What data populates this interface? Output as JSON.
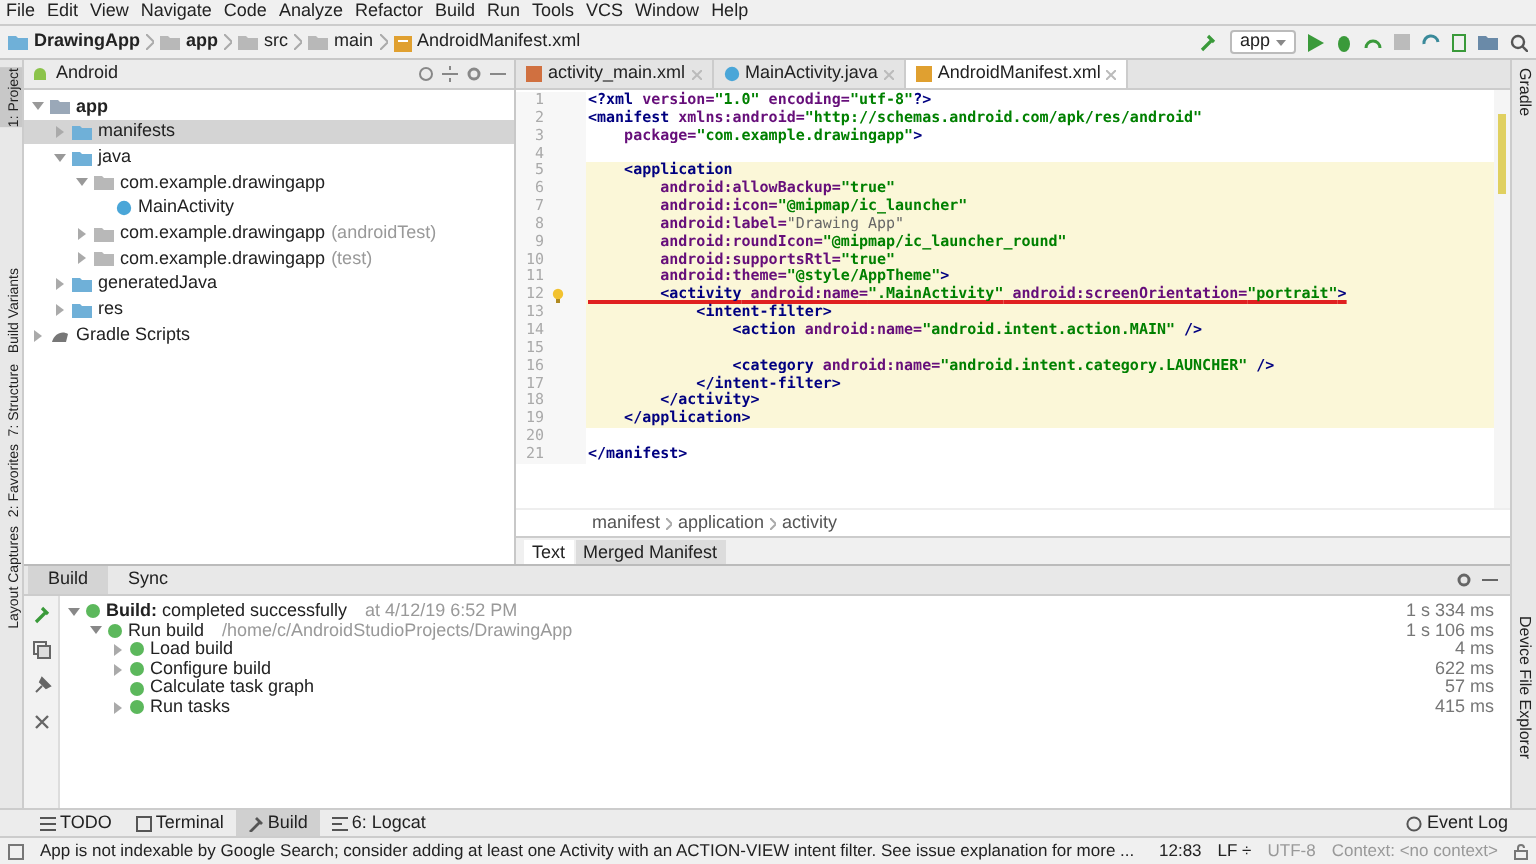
{
  "menu": [
    "File",
    "Edit",
    "View",
    "Navigate",
    "Code",
    "Analyze",
    "Refactor",
    "Build",
    "Run",
    "Tools",
    "VCS",
    "Window",
    "Help"
  ],
  "breadcrumb": [
    "DrawingApp",
    "app",
    "src",
    "main",
    "AndroidManifest.xml"
  ],
  "run_config": "app",
  "left_stripe": [
    {
      "label": "1: Project",
      "selected": true
    },
    {
      "label": "Build Variants",
      "selected": false
    },
    {
      "label": "7: Structure",
      "selected": false
    },
    {
      "label": "2: Favorites",
      "selected": false
    },
    {
      "label": "Layout Captures",
      "selected": false
    }
  ],
  "right_stripe": [
    "Gradle",
    "Device File Explorer"
  ],
  "project": {
    "view": "Android",
    "tree": [
      {
        "label": "app",
        "kind": "module",
        "expanded": true,
        "selected": false,
        "children": [
          {
            "label": "manifests",
            "kind": "folder",
            "expanded": false,
            "selected": true
          },
          {
            "label": "java",
            "kind": "folder",
            "expanded": true,
            "selected": false,
            "children": [
              {
                "label": "com.example.drawingapp",
                "kind": "package",
                "expanded": true,
                "selected": false,
                "children": [
                  {
                    "label": "MainActivity",
                    "kind": "class",
                    "selected": false
                  }
                ]
              },
              {
                "label": "com.example.drawingapp",
                "note": "(androidTest)",
                "kind": "package",
                "expanded": false,
                "selected": false
              },
              {
                "label": "com.example.drawingapp",
                "note": "(test)",
                "kind": "package",
                "expanded": false,
                "selected": false
              }
            ]
          },
          {
            "label": "generatedJava",
            "kind": "folder",
            "expanded": false,
            "selected": false
          },
          {
            "label": "res",
            "kind": "folder",
            "expanded": false,
            "selected": false
          }
        ]
      },
      {
        "label": "Gradle Scripts",
        "kind": "gradle",
        "expanded": false,
        "selected": false
      }
    ]
  },
  "editor_tabs": [
    {
      "label": "activity_main.xml",
      "kind": "layout",
      "selected": false
    },
    {
      "label": "MainActivity.java",
      "kind": "class",
      "selected": false
    },
    {
      "label": "AndroidManifest.xml",
      "kind": "manifest",
      "selected": true
    }
  ],
  "code": [
    {
      "number": "1",
      "highlighted": false,
      "tokens": [
        {
          "kind": "tag",
          "text": "<?xml"
        },
        {
          "kind": "attr",
          "text": " version="
        },
        {
          "kind": "val",
          "text": "\"1.0\""
        },
        {
          "kind": "attr",
          "text": " encoding="
        },
        {
          "kind": "val",
          "text": "\"utf-8\""
        },
        {
          "kind": "tag",
          "text": "?>"
        }
      ]
    },
    {
      "number": "2",
      "highlighted": false,
      "tokens": [
        {
          "kind": "tag",
          "text": "<manifest"
        },
        {
          "kind": "attr",
          "text": " xmlns:android="
        },
        {
          "kind": "val",
          "text": "\"http://schemas.android.com/apk/res/android\""
        }
      ]
    },
    {
      "number": "3",
      "highlighted": false,
      "tokens": [
        {
          "kind": "attr",
          "text": "    package="
        },
        {
          "kind": "val",
          "text": "\"com.example.drawingapp\""
        },
        {
          "kind": "tag",
          "text": ">"
        }
      ]
    },
    {
      "number": "4",
      "highlighted": false
    },
    {
      "number": "5",
      "highlighted": true,
      "tokens": [
        {
          "kind": "tag",
          "text": "    <application"
        }
      ]
    },
    {
      "number": "6",
      "highlighted": true,
      "tokens": [
        {
          "kind": "attr",
          "text": "        android:allowBackup="
        },
        {
          "kind": "val",
          "text": "\"true\""
        }
      ]
    },
    {
      "number": "7",
      "highlighted": true,
      "tokens": [
        {
          "kind": "attr",
          "text": "        android:icon="
        },
        {
          "kind": "val",
          "text": "\"@mipmap/ic_launcher\""
        }
      ]
    },
    {
      "number": "8",
      "highlighted": true,
      "tokens": [
        {
          "kind": "attr",
          "text": "        android:label="
        },
        {
          "kind": "fold",
          "text": "\"Drawing App\""
        }
      ]
    },
    {
      "number": "9",
      "highlighted": true,
      "tokens": [
        {
          "kind": "attr",
          "text": "        android:roundIcon="
        },
        {
          "kind": "val",
          "text": "\"@mipmap/ic_launcher_round\""
        }
      ]
    },
    {
      "number": "10",
      "highlighted": true,
      "tokens": [
        {
          "kind": "attr",
          "text": "        android:supportsRtl="
        },
        {
          "kind": "val",
          "text": "\"true\""
        }
      ]
    },
    {
      "number": "11",
      "highlighted": true,
      "tokens": [
        {
          "kind": "attr",
          "text": "        android:theme="
        },
        {
          "kind": "val",
          "text": "\"@style/AppTheme\""
        },
        {
          "kind": "tag",
          "text": ">"
        }
      ]
    },
    {
      "number": "12",
      "highlighted": true,
      "bulb": true,
      "underlined": true,
      "tokens": [
        {
          "kind": "tag",
          "text": "        <activity"
        },
        {
          "kind": "attr",
          "text": " android:name="
        },
        {
          "kind": "val",
          "text": "\".MainActivity\""
        },
        {
          "kind": "attr",
          "text": " android:screenOrientation="
        },
        {
          "kind": "val",
          "text": "\"portrait\""
        },
        {
          "kind": "tag",
          "text": ">"
        }
      ]
    },
    {
      "number": "13",
      "highlighted": true,
      "tokens": [
        {
          "kind": "tag",
          "text": "            <intent-filter>"
        }
      ]
    },
    {
      "number": "14",
      "highlighted": true,
      "tokens": [
        {
          "kind": "tag",
          "text": "                <action"
        },
        {
          "kind": "attr",
          "text": " android:name="
        },
        {
          "kind": "val",
          "text": "\"android.intent.action.MAIN\""
        },
        {
          "kind": "tag",
          "text": " />"
        }
      ]
    },
    {
      "number": "15",
      "highlighted": true
    },
    {
      "number": "16",
      "highlighted": true,
      "tokens": [
        {
          "kind": "tag",
          "text": "                <category"
        },
        {
          "kind": "attr",
          "text": " android:name="
        },
        {
          "kind": "val",
          "text": "\"android.intent.category.LAUNCHER\""
        },
        {
          "kind": "tag",
          "text": " />"
        }
      ]
    },
    {
      "number": "17",
      "highlighted": true,
      "tokens": [
        {
          "kind": "tag",
          "text": "            </intent-filter>"
        }
      ]
    },
    {
      "number": "18",
      "highlighted": true,
      "tokens": [
        {
          "kind": "tag",
          "text": "        </activity>"
        }
      ]
    },
    {
      "number": "19",
      "highlighted": true,
      "tokens": [
        {
          "kind": "tag",
          "text": "    </application>"
        }
      ]
    },
    {
      "number": "20",
      "highlighted": false
    },
    {
      "number": "21",
      "highlighted": false,
      "tokens": [
        {
          "kind": "tag",
          "text": "</manifest>"
        }
      ]
    }
  ],
  "editor_path": [
    "manifest",
    "application",
    "activity"
  ],
  "editor_bottom_tabs": [
    {
      "label": "Text",
      "selected": true
    },
    {
      "label": "Merged Manifest",
      "selected": false
    }
  ],
  "build_tabs": [
    {
      "label": "Build",
      "selected": true
    },
    {
      "label": "Sync",
      "selected": false
    }
  ],
  "build_tree": [
    {
      "label": "**Build:** completed successfully",
      "detail": "at 4/12/19 6:52 PM",
      "time": "1 s 334 ms",
      "expanded": true,
      "children": [
        {
          "label": "Run build",
          "detail": "/home/c/AndroidStudioProjects/DrawingApp",
          "time": "1 s 106 ms",
          "expanded": true,
          "children": [
            {
              "label": "Load build",
              "time": "4 ms",
              "expanded": false,
              "has_children": true
            },
            {
              "label": "Configure build",
              "time": "622 ms",
              "expanded": false,
              "has_children": true
            },
            {
              "label": "Calculate task graph",
              "time": "57 ms",
              "expanded": false,
              "has_children": false
            },
            {
              "label": "Run tasks",
              "time": "415 ms",
              "expanded": false,
              "has_children": true
            }
          ]
        }
      ]
    }
  ],
  "tool_tabs": [
    {
      "label": "TODO",
      "kind": "list",
      "selected": false
    },
    {
      "label": "Terminal",
      "kind": "terminal",
      "selected": false
    },
    {
      "label": "Build",
      "kind": "hammer",
      "selected": true
    },
    {
      "label": "6: Logcat",
      "kind": "log",
      "selected": false
    }
  ],
  "event_log": "Event Log",
  "status": {
    "message": "App is not indexable by Google Search; consider adding at least one Activity with an ACTION-VIEW intent filter. See issue explanation for more ...",
    "position": "12:83",
    "line_sep": "LF ÷",
    "encoding": "UTF-8",
    "context": "Context: <no context>"
  }
}
